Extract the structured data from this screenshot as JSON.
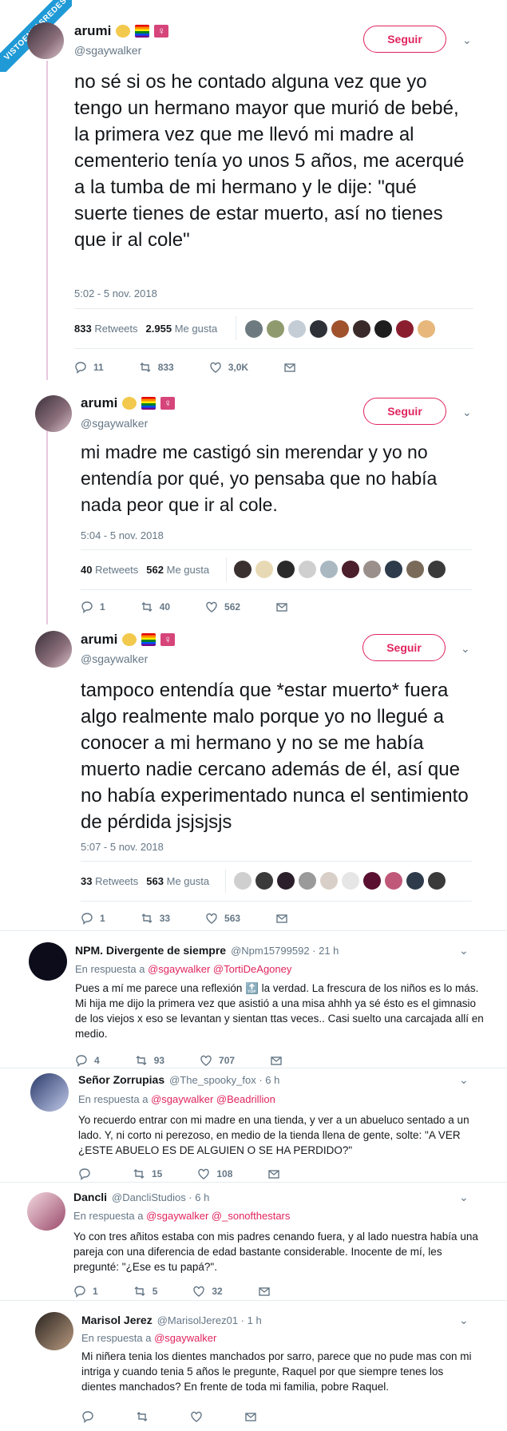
{
  "watermark": "VISTOENLASREDES",
  "thread": [
    {
      "name": "arumi",
      "handle": "@sgaywalker",
      "follow_label": "Seguir",
      "text": "no sé si os he contado alguna vez que yo tengo un hermano mayor que murió de bebé, la primera vez que me llevó mi madre al cementerio tenía yo unos 5 años, me acerqué a la tumba de mi hermano y le dije: \"qué suerte tienes de estar muerto, así no tienes que ir al cole\"",
      "time": "5:02 - 5 nov. 2018",
      "retweets_num": "833",
      "retweets_label": "Retweets",
      "likes_num": "2.955",
      "likes_label": "Me gusta",
      "actions": {
        "replies": "11",
        "retweets": "833",
        "likes": "3,0K"
      }
    },
    {
      "name": "arumi",
      "handle": "@sgaywalker",
      "follow_label": "Seguir",
      "text": "mi madre me castigó sin merendar y yo no entendía por qué, yo pensaba que no había nada peor que ir al cole.",
      "time": "5:04 - 5 nov. 2018",
      "retweets_num": "40",
      "retweets_label": "Retweets",
      "likes_num": "562",
      "likes_label": "Me gusta",
      "actions": {
        "replies": "1",
        "retweets": "40",
        "likes": "562"
      }
    },
    {
      "name": "arumi",
      "handle": "@sgaywalker",
      "follow_label": "Seguir",
      "text": "tampoco entendía que *estar muerto* fuera algo realmente malo porque yo no llegué a conocer a mi hermano y no se me había muerto nadie cercano además de él, así que no había experimentado nunca el sentimiento de pérdida jsjsjsjs",
      "time": "5:07 - 5 nov. 2018",
      "retweets_num": "33",
      "retweets_label": "Retweets",
      "likes_num": "563",
      "likes_label": "Me gusta",
      "actions": {
        "replies": "1",
        "retweets": "33",
        "likes": "563"
      }
    }
  ],
  "replies": [
    {
      "name": "NPM. Divergente de siempre",
      "handle": "@Npm15799592 · 21 h",
      "in_reply_label": "En respuesta a",
      "mentions": "@sgaywalker @TortiDeAgoney",
      "text": "Pues a mí me parece una reflexión 🔝 la verdad. La frescura de los niños es lo más. Mi hija me dijo la primera vez que asistió a una misa ahhh ya sé ésto es el gimnasio de los viejos x eso se levantan y sientan ttas veces.. Casi suelto una carcajada allí en medio.",
      "actions": {
        "replies": "4",
        "retweets": "93",
        "likes": "707"
      }
    },
    {
      "name": "Señor Zorrupias",
      "handle": "@The_spooky_fox · 6 h",
      "in_reply_label": "En respuesta a",
      "mentions": "@sgaywalker @Beadrillion",
      "text": "Yo recuerdo entrar con mi madre en una tienda, y ver a un abueluco sentado a un lado. Y, ni corto ni perezoso, en medio de la tienda llena de gente, solte: \"A VER ¿ESTE ABUELO ES DE ALGUIEN O SE HA PERDIDO?\"",
      "actions": {
        "replies": "",
        "retweets": "15",
        "likes": "108"
      }
    },
    {
      "name": "Dancli",
      "handle": "@DancliStudios · 6 h",
      "in_reply_label": "En respuesta a",
      "mentions": "@sgaywalker @_sonofthestars",
      "text": "Yo con tres añitos estaba con mis padres cenando fuera, y al lado nuestra había una pareja con una diferencia de edad bastante considerable. Inocente de mí, les pregunté: \"¿Ese es tu papá?\".",
      "actions": {
        "replies": "1",
        "retweets": "5",
        "likes": "32"
      }
    },
    {
      "name": "Marisol Jerez",
      "handle": "@MarisolJerez01 · 1 h",
      "in_reply_label": "En respuesta a",
      "mentions": "@sgaywalker",
      "text": "Mi niñera tenia los dientes manchados por sarro, parece que no pude mas con mi intriga y cuando tenia 5 años le pregunte, Raquel por que siempre tenes los dientes manchados? En frente de toda mi familia, pobre Raquel.",
      "actions": {
        "replies": "",
        "retweets": "",
        "likes": ""
      }
    }
  ],
  "colors": {
    "accent": "#e0245e",
    "muted": "#657786",
    "thread_line": "#e8c9de",
    "badge": "#1f9ad6"
  }
}
